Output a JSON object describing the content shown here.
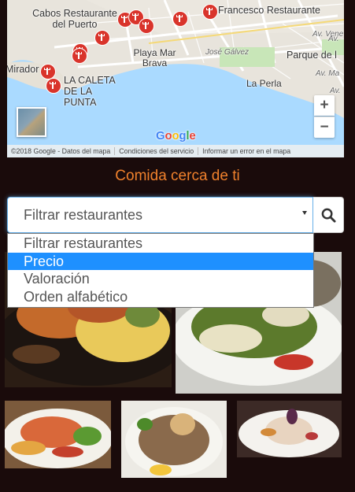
{
  "map": {
    "labels": {
      "cabos": "Cabos Restaurante del Puerto",
      "francesco": "Francesco Restaurante",
      "playa": "Playa Mar Brava",
      "mirador": "Mirador",
      "caleta": "LA CALETA DE LA PUNTA",
      "parque": "Parque de l",
      "perla": "La Perla",
      "venezuela": "Av. Vene",
      "jose_galvez": "José Gálvez",
      "av1": "Av.",
      "av2": "Av. Ma",
      "av3": "Av."
    },
    "zoom_in": "+",
    "zoom_out": "−",
    "logo": {
      "g1": "G",
      "o1": "o",
      "o2": "o",
      "g2": "g",
      "l": "l",
      "e": "e"
    },
    "attribution": [
      "©2018 Google - Datos del mapa",
      "Condiciones del servicio",
      "Informar un error en el mapa"
    ]
  },
  "section_title": "Comida cerca de ti",
  "filter": {
    "selected": "Filtrar restaurantes",
    "options": [
      "Filtrar restaurantes",
      "Precio",
      "Valoración",
      "Orden alfabético"
    ],
    "highlighted_index": 1
  },
  "colors": {
    "accent": "#f0812c",
    "background": "#1a0b0b",
    "pin": "#d9342b",
    "highlight": "#1e90ff"
  }
}
